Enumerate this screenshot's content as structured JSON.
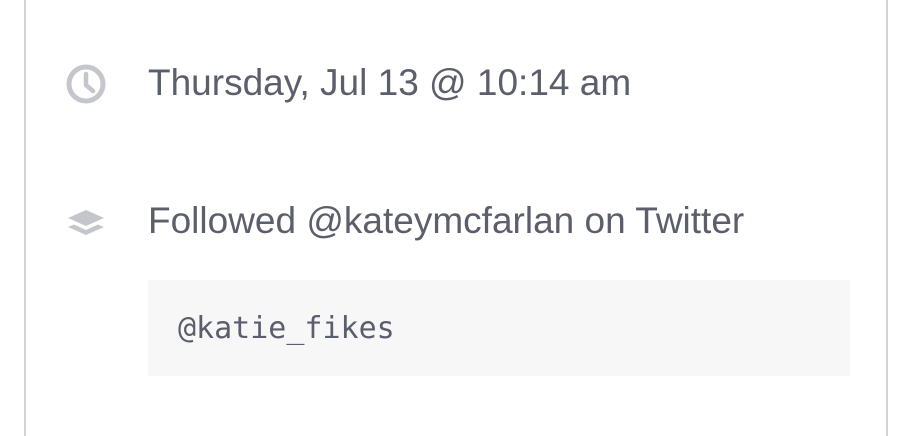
{
  "event": {
    "time_icon": "clock-icon",
    "timestamp": "Thursday, Jul 13 @ 10:14 am",
    "activity_icon": "layers-icon",
    "activity_text": "Followed @kateymcfarlan on Twitter",
    "detail_text": "@katie_fikes"
  },
  "colors": {
    "text": "#5b5e6b",
    "icon": "#c5c6cc",
    "code_background": "#f7f7f8",
    "border": "#d2d2d6"
  }
}
